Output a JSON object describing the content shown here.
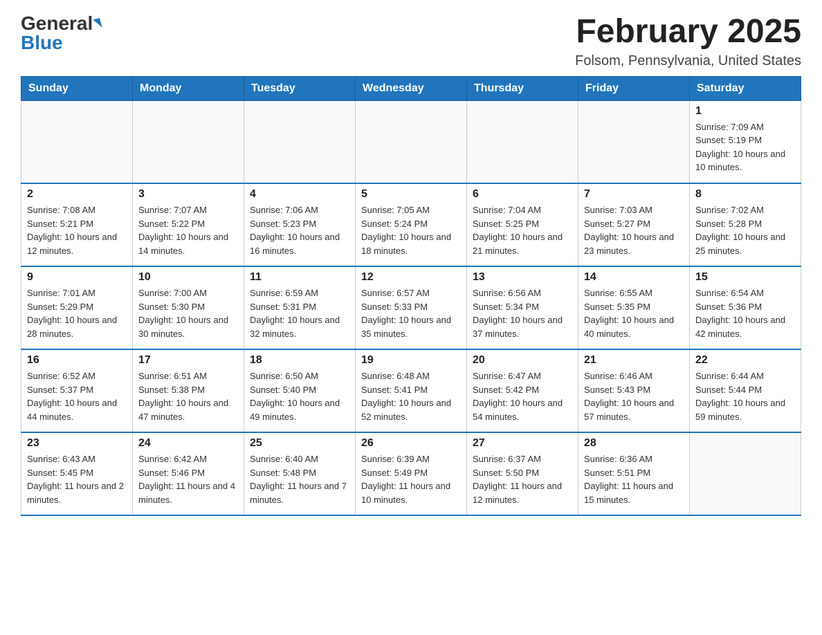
{
  "header": {
    "logo_general": "General",
    "logo_blue": "Blue",
    "month_title": "February 2025",
    "location": "Folsom, Pennsylvania, United States"
  },
  "days_of_week": [
    "Sunday",
    "Monday",
    "Tuesday",
    "Wednesday",
    "Thursday",
    "Friday",
    "Saturday"
  ],
  "weeks": [
    [
      {
        "day": "",
        "info": ""
      },
      {
        "day": "",
        "info": ""
      },
      {
        "day": "",
        "info": ""
      },
      {
        "day": "",
        "info": ""
      },
      {
        "day": "",
        "info": ""
      },
      {
        "day": "",
        "info": ""
      },
      {
        "day": "1",
        "info": "Sunrise: 7:09 AM\nSunset: 5:19 PM\nDaylight: 10 hours and 10 minutes."
      }
    ],
    [
      {
        "day": "2",
        "info": "Sunrise: 7:08 AM\nSunset: 5:21 PM\nDaylight: 10 hours and 12 minutes."
      },
      {
        "day": "3",
        "info": "Sunrise: 7:07 AM\nSunset: 5:22 PM\nDaylight: 10 hours and 14 minutes."
      },
      {
        "day": "4",
        "info": "Sunrise: 7:06 AM\nSunset: 5:23 PM\nDaylight: 10 hours and 16 minutes."
      },
      {
        "day": "5",
        "info": "Sunrise: 7:05 AM\nSunset: 5:24 PM\nDaylight: 10 hours and 18 minutes."
      },
      {
        "day": "6",
        "info": "Sunrise: 7:04 AM\nSunset: 5:25 PM\nDaylight: 10 hours and 21 minutes."
      },
      {
        "day": "7",
        "info": "Sunrise: 7:03 AM\nSunset: 5:27 PM\nDaylight: 10 hours and 23 minutes."
      },
      {
        "day": "8",
        "info": "Sunrise: 7:02 AM\nSunset: 5:28 PM\nDaylight: 10 hours and 25 minutes."
      }
    ],
    [
      {
        "day": "9",
        "info": "Sunrise: 7:01 AM\nSunset: 5:29 PM\nDaylight: 10 hours and 28 minutes."
      },
      {
        "day": "10",
        "info": "Sunrise: 7:00 AM\nSunset: 5:30 PM\nDaylight: 10 hours and 30 minutes."
      },
      {
        "day": "11",
        "info": "Sunrise: 6:59 AM\nSunset: 5:31 PM\nDaylight: 10 hours and 32 minutes."
      },
      {
        "day": "12",
        "info": "Sunrise: 6:57 AM\nSunset: 5:33 PM\nDaylight: 10 hours and 35 minutes."
      },
      {
        "day": "13",
        "info": "Sunrise: 6:56 AM\nSunset: 5:34 PM\nDaylight: 10 hours and 37 minutes."
      },
      {
        "day": "14",
        "info": "Sunrise: 6:55 AM\nSunset: 5:35 PM\nDaylight: 10 hours and 40 minutes."
      },
      {
        "day": "15",
        "info": "Sunrise: 6:54 AM\nSunset: 5:36 PM\nDaylight: 10 hours and 42 minutes."
      }
    ],
    [
      {
        "day": "16",
        "info": "Sunrise: 6:52 AM\nSunset: 5:37 PM\nDaylight: 10 hours and 44 minutes."
      },
      {
        "day": "17",
        "info": "Sunrise: 6:51 AM\nSunset: 5:38 PM\nDaylight: 10 hours and 47 minutes."
      },
      {
        "day": "18",
        "info": "Sunrise: 6:50 AM\nSunset: 5:40 PM\nDaylight: 10 hours and 49 minutes."
      },
      {
        "day": "19",
        "info": "Sunrise: 6:48 AM\nSunset: 5:41 PM\nDaylight: 10 hours and 52 minutes."
      },
      {
        "day": "20",
        "info": "Sunrise: 6:47 AM\nSunset: 5:42 PM\nDaylight: 10 hours and 54 minutes."
      },
      {
        "day": "21",
        "info": "Sunrise: 6:46 AM\nSunset: 5:43 PM\nDaylight: 10 hours and 57 minutes."
      },
      {
        "day": "22",
        "info": "Sunrise: 6:44 AM\nSunset: 5:44 PM\nDaylight: 10 hours and 59 minutes."
      }
    ],
    [
      {
        "day": "23",
        "info": "Sunrise: 6:43 AM\nSunset: 5:45 PM\nDaylight: 11 hours and 2 minutes."
      },
      {
        "day": "24",
        "info": "Sunrise: 6:42 AM\nSunset: 5:46 PM\nDaylight: 11 hours and 4 minutes."
      },
      {
        "day": "25",
        "info": "Sunrise: 6:40 AM\nSunset: 5:48 PM\nDaylight: 11 hours and 7 minutes."
      },
      {
        "day": "26",
        "info": "Sunrise: 6:39 AM\nSunset: 5:49 PM\nDaylight: 11 hours and 10 minutes."
      },
      {
        "day": "27",
        "info": "Sunrise: 6:37 AM\nSunset: 5:50 PM\nDaylight: 11 hours and 12 minutes."
      },
      {
        "day": "28",
        "info": "Sunrise: 6:36 AM\nSunset: 5:51 PM\nDaylight: 11 hours and 15 minutes."
      },
      {
        "day": "",
        "info": ""
      }
    ]
  ]
}
